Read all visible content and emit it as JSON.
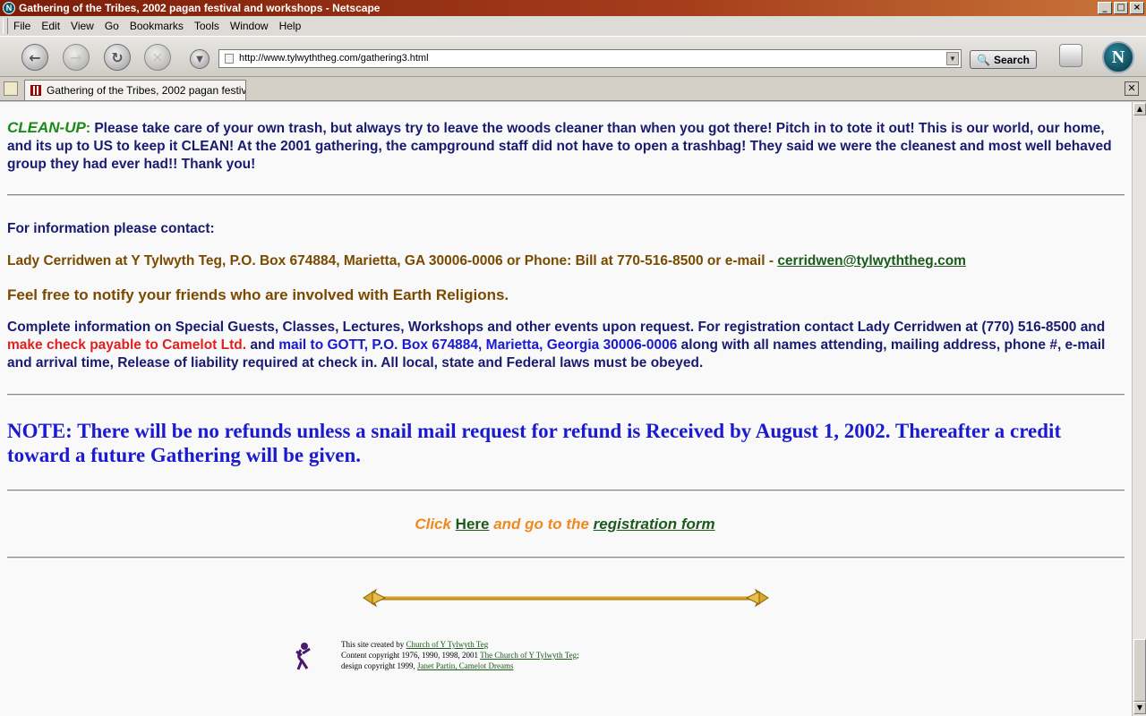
{
  "window": {
    "title": "Gathering of the Tribes, 2002 pagan festival and workshops - Netscape",
    "controls": [
      "_",
      "□",
      "×"
    ]
  },
  "menu": [
    "File",
    "Edit",
    "View",
    "Go",
    "Bookmarks",
    "Tools",
    "Window",
    "Help"
  ],
  "toolbar": {
    "url": "http://www.tylwyththeg.com/gathering3.html",
    "search_label": "Search",
    "logo_letter": "N"
  },
  "tab": {
    "title": "Gathering of the Tribes, 2002 pagan festival ..."
  },
  "page": {
    "cleanup_heading": "CLEAN-UP",
    "cleanup_colon": ":",
    "cleanup_text": "  Please take care of your own trash, but always try to leave the woods cleaner than when you got there! Pitch in to tote it out! This is our world, our home, and its up to US to keep it CLEAN!  At the 2001 gathering, the campground staff did not have to open a trashbag!  They said we were the cleanest and most well behaved group they had ever had!!  Thank you!",
    "contact_heading": "For information please contact:",
    "contact_line": "Lady Cerridwen at Y Tylwyth Teg, P.O. Box 674884, Marietta, GA 30006-0006 or Phone: Bill at 770-516-8500 or e-mail - ",
    "contact_email": "cerridwen@tylwyththeg.com",
    "notify_text": "Feel free to notify your friends who are involved with Earth Religions.",
    "info_1": "Complete information on Special Guests, Classes, Lectures, Workshops and other events upon request.   For registration contact Lady Cerridwen at (770) 516-8500 and ",
    "info_red": "make check payable to  Camelot Ltd.",
    "info_2": " and ",
    "info_blue": "mail to GOTT, P.O. Box 674884, Marietta, Georgia 30006-0006",
    "info_3": " along with all names attending, mailing address, phone #, e-mail and arrival time, Release of liability required at check in.  All local, state and Federal laws must be obeyed.",
    "note_text": "NOTE:  There will be no refunds unless a snail mail request for refund is Received by August 1, 2002.   Thereafter a credit toward a future Gathering will be given.",
    "click_pre": "Click ",
    "click_here": "Here",
    "click_mid": " and go to the ",
    "click_link": "registration form",
    "footer_line1_pre": "This site created by ",
    "footer_line1_link": "Church of Y Tylwyth Teg",
    "footer_line2_pre": "Content copyright 1976, 1990, 1998, 2001 ",
    "footer_line2_link": "The Church of Y Tylwyth Teg",
    "footer_line2_post": ";",
    "footer_line3_pre": "design copyright 1999, ",
    "footer_line3_link": "Janet Partin, Camelot Dreams"
  },
  "colors": {
    "cleanup_green": "#1a8a1a",
    "navy": "#1a1a70",
    "brown": "#7a4a00",
    "red": "#e02020",
    "blue": "#1a1ad0",
    "orange": "#f08a20"
  }
}
